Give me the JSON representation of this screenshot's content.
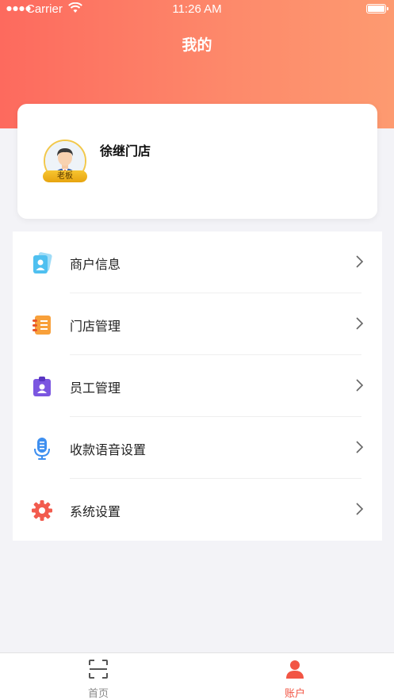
{
  "status_bar": {
    "carrier": "Carrier",
    "time": "11:26 AM"
  },
  "header": {
    "title": "我的"
  },
  "profile": {
    "store_name": "徐继门店",
    "role_badge": "老板"
  },
  "menu": [
    {
      "label": "商户信息",
      "icon": "merchant-card-icon",
      "color": "#4fc0f0"
    },
    {
      "label": "门店管理",
      "icon": "store-notebook-icon",
      "color": "#f8a03a"
    },
    {
      "label": "员工管理",
      "icon": "employee-badge-icon",
      "color": "#7b56e0"
    },
    {
      "label": "收款语音设置",
      "icon": "voice-mic-icon",
      "color": "#3e8ff0"
    },
    {
      "label": "系统设置",
      "icon": "settings-gear-icon",
      "color": "#f25b4e"
    }
  ],
  "tabbar": {
    "home_label": "首页",
    "account_label": "账户"
  },
  "colors": {
    "header_gradient_start": "#fd6a5e",
    "header_gradient_end": "#fd9a70",
    "active_tab": "#f25544"
  }
}
